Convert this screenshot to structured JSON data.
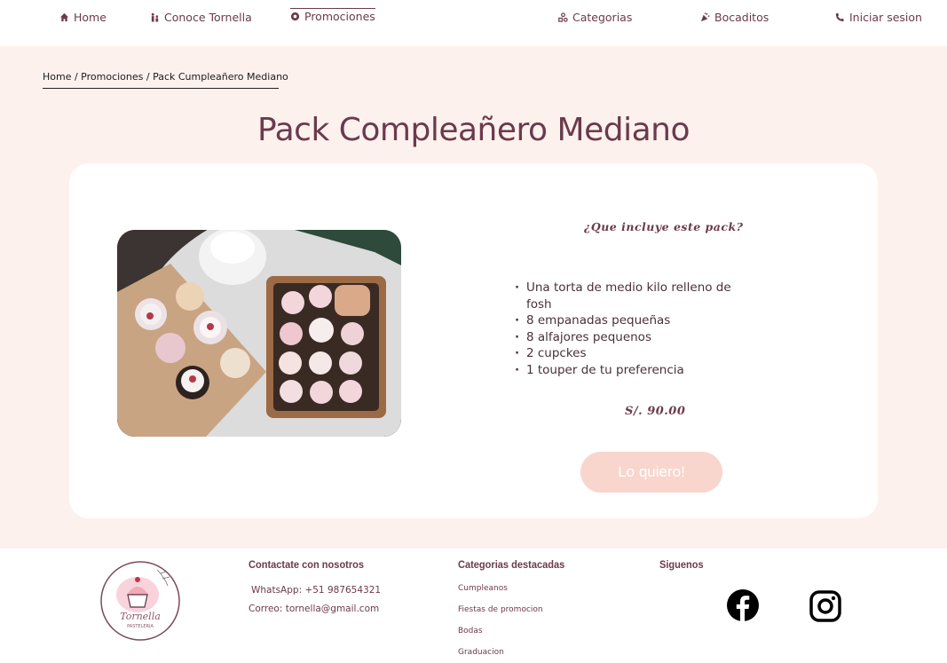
{
  "nav": {
    "items": [
      {
        "label": "Home",
        "icon": "home-icon"
      },
      {
        "label": "Conoce Tornella",
        "icon": "people-icon"
      },
      {
        "label": "Promociones",
        "icon": "badge-icon",
        "active": true
      },
      {
        "label": "Categorias",
        "icon": "shapes-icon"
      },
      {
        "label": "Bocaditos",
        "icon": "party-icon"
      },
      {
        "label": "Iniciar sesion",
        "icon": "user-phone-icon"
      }
    ]
  },
  "breadcrumb": "Home / Promociones / Pack Cumpleañero Mediano",
  "product": {
    "title": "Pack Compleañero Mediano",
    "includes_title": "¿Que incluye este pack?",
    "includes": [
      "Una torta de medio kilo relleno de fosh",
      "8 empanadas pequeñas",
      "8 alfajores pequenos",
      "2 cupckes",
      "1 touper de tu preferencia"
    ],
    "price": "S/. 90.00",
    "cta_label": "Lo quiero!"
  },
  "footer": {
    "logo_text": "Tornella",
    "logo_sub": "PASTELERIA",
    "contact_title": "Contactate con nosotros",
    "whatsapp": "WhatsApp: +51 987654321",
    "email": "Correo: tornella@gmail.com",
    "categories_title": "Categorias destacadas",
    "categories": [
      "Cumpleanos",
      "Fiestas de promocion",
      "Bodas",
      "Graduacion"
    ],
    "social_title": "Siguenos",
    "social": [
      "facebook-icon",
      "instagram-icon"
    ]
  },
  "colors": {
    "brand": "#6b3a4c",
    "background": "#fdf1ee",
    "cta": "#f8d5cd"
  }
}
